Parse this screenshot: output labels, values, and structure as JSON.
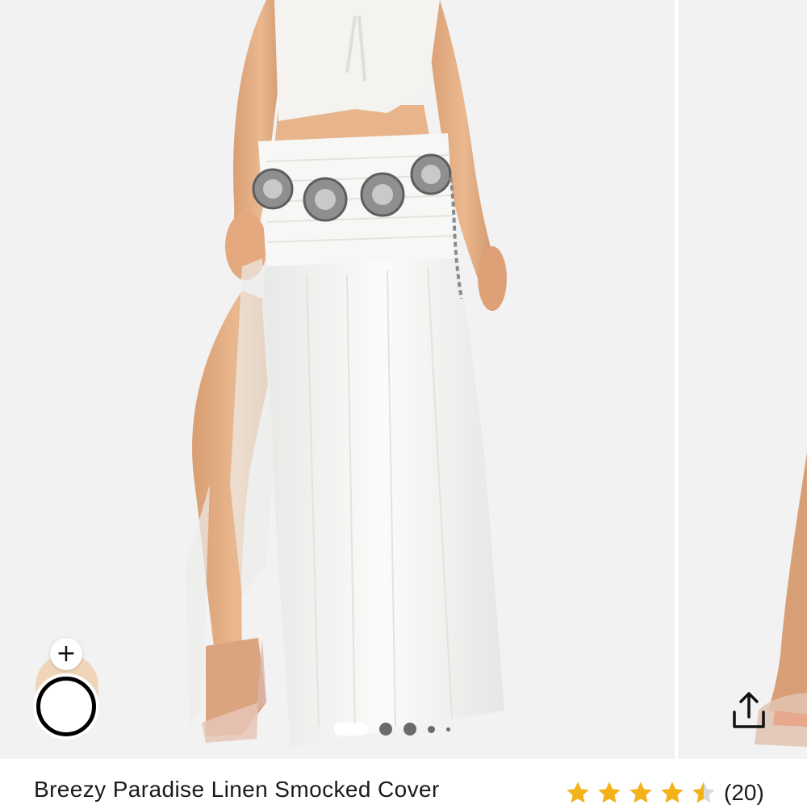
{
  "product": {
    "name": "Breezy Paradise Linen Smocked Cover",
    "rating": 4.5,
    "rating_max": 5,
    "review_count": "(20)"
  },
  "gallery": {
    "image_count": 5,
    "active_index": 0,
    "try_on_plus": "+"
  },
  "icons": {
    "share": "share-icon",
    "star": "star-icon",
    "plus": "plus-icon"
  },
  "colors": {
    "star": "#f3b21a",
    "star_empty": "#d9d9d9",
    "text": "#1a1a1a",
    "skin_swatch": "#f1d5b9"
  }
}
